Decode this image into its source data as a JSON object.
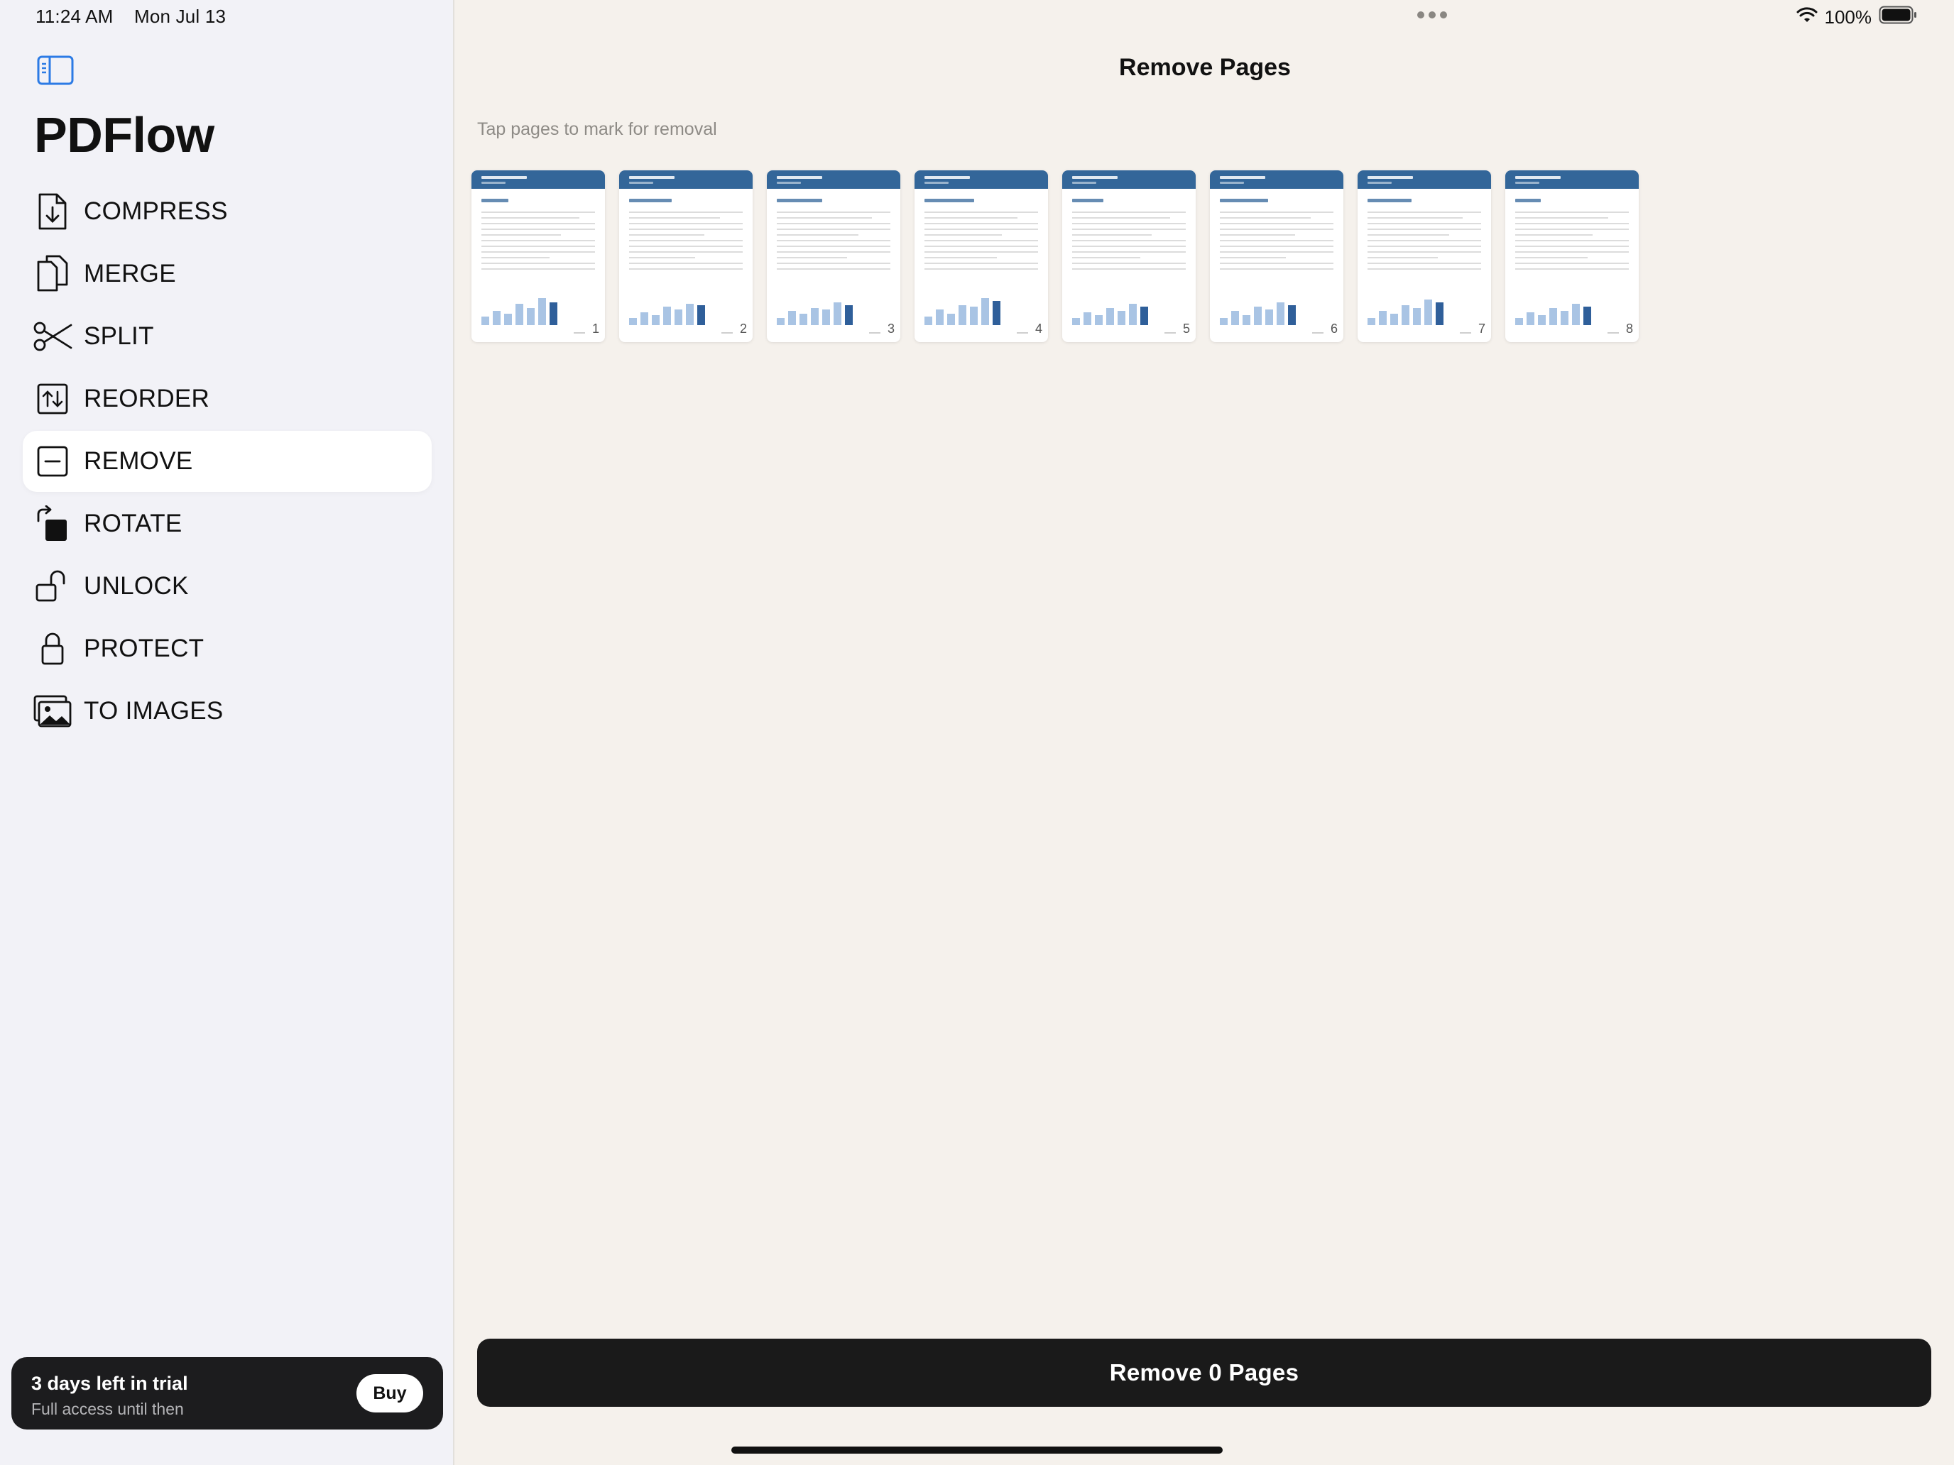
{
  "status_bar": {
    "time": "11:24 AM",
    "date": "Mon Jul 13",
    "battery": "100%"
  },
  "sidebar": {
    "app_title": "PDFlow",
    "items": [
      {
        "label": "COMPRESS",
        "icon": "compress-icon"
      },
      {
        "label": "MERGE",
        "icon": "merge-icon"
      },
      {
        "label": "SPLIT",
        "icon": "scissors-icon"
      },
      {
        "label": "REORDER",
        "icon": "reorder-icon"
      },
      {
        "label": "REMOVE",
        "icon": "remove-icon",
        "active": true
      },
      {
        "label": "ROTATE",
        "icon": "rotate-icon"
      },
      {
        "label": "UNLOCK",
        "icon": "unlock-icon"
      },
      {
        "label": "PROTECT",
        "icon": "lock-icon"
      },
      {
        "label": "TO IMAGES",
        "icon": "images-icon"
      }
    ],
    "trial": {
      "title": "3 days left in trial",
      "subtitle": "Full access until then",
      "buy_label": "Buy"
    }
  },
  "main": {
    "title": "Remove Pages",
    "hint": "Tap pages to mark for removal",
    "pages": [
      {
        "number": "1"
      },
      {
        "number": "2"
      },
      {
        "number": "3"
      },
      {
        "number": "4"
      },
      {
        "number": "5"
      },
      {
        "number": "6"
      },
      {
        "number": "7"
      },
      {
        "number": "8"
      }
    ],
    "action_label": "Remove 0 Pages"
  },
  "colors": {
    "accent_blue": "#336699",
    "sidebar_toggle": "#2c7be5",
    "main_background": "#f5f1ec",
    "sidebar_background": "#f2f2f7",
    "button_dark": "#1a1a1a"
  }
}
